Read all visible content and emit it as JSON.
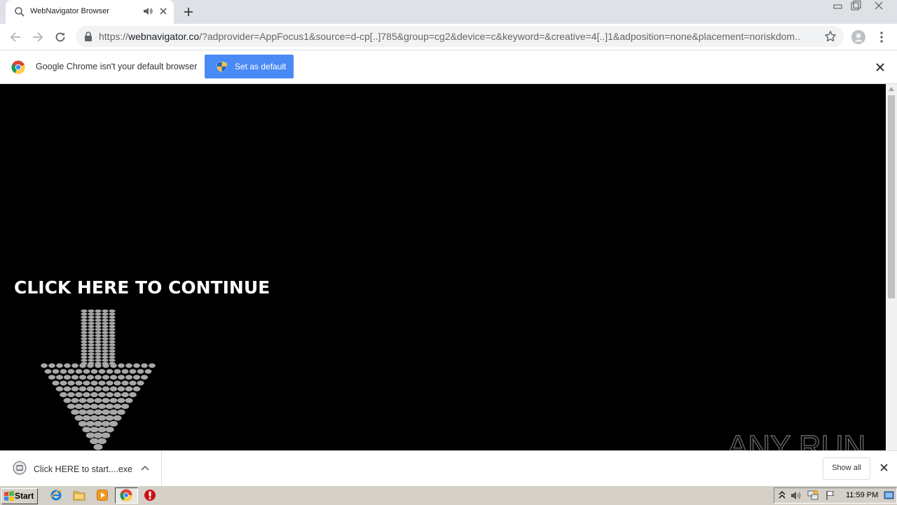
{
  "browser": {
    "tab": {
      "title": "WebNavigator Browser"
    },
    "address": {
      "scheme": "https://",
      "host": "webnavigator.co",
      "rest": "/?adprovider=AppFocus1&source=d-cp[..]785&group=cg2&device=c&keyword=&creative=4[..]1&adposition=none&placement=noriskdom..."
    }
  },
  "infobar": {
    "message": "Google Chrome isn't your default browser",
    "button_label": "Set as default"
  },
  "page": {
    "cta_text": "CLICK HERE TO CONTINUE",
    "watermark": "ANY RUN"
  },
  "download_shelf": {
    "file_name": "Click HERE to start....exe",
    "show_all_label": "Show all"
  },
  "taskbar": {
    "start_label": "Start",
    "clock": "11:59 PM"
  },
  "colors": {
    "accent": "#4a8af4",
    "page_background": "#000000",
    "arrow_dots": "#a8a8a8",
    "opera_red": "#cc0f16"
  },
  "icons": [
    "search-icon",
    "speaker-icon",
    "close-icon",
    "plus-icon",
    "back-icon",
    "forward-icon",
    "reload-icon",
    "lock-icon",
    "star-icon",
    "profile-icon",
    "kebab-menu-icon",
    "chrome-logo-icon",
    "shield-icon",
    "download-file-icon",
    "chevron-up-icon",
    "windows-flag-icon",
    "ie-icon",
    "folder-icon",
    "media-player-icon",
    "opera-icon",
    "network-icon",
    "volume-icon",
    "flag-icon"
  ]
}
